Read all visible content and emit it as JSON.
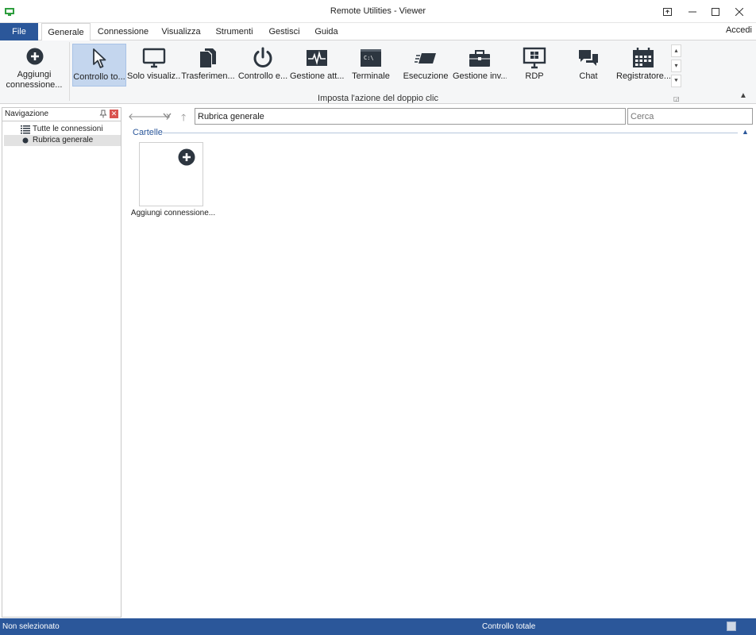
{
  "window": {
    "title": "Remote Utilities - Viewer"
  },
  "tabs": [
    {
      "label": "File"
    },
    {
      "label": "Generale"
    },
    {
      "label": "Connessione"
    },
    {
      "label": "Visualizza"
    },
    {
      "label": "Strumenti"
    },
    {
      "label": "Gestisci"
    },
    {
      "label": "Guida"
    }
  ],
  "accedi": "Accedi",
  "ribbon": {
    "add_connection_label": "Aggiungi connessione...",
    "gallery": [
      {
        "label": "Controllo to...",
        "icon": "cursor-icon"
      },
      {
        "label": "Solo visualiz...",
        "icon": "monitor-icon"
      },
      {
        "label": "Trasferimen...",
        "icon": "files-icon"
      },
      {
        "label": "Controllo e...",
        "icon": "power-icon"
      },
      {
        "label": "Gestione att...",
        "icon": "activity-monitor-icon"
      },
      {
        "label": "Terminale",
        "icon": "terminal-icon"
      },
      {
        "label": "Esecuzione",
        "icon": "execute-icon"
      },
      {
        "label": "Gestione inv...",
        "icon": "inventory-icon"
      },
      {
        "label": "RDP",
        "icon": "rdp-icon"
      },
      {
        "label": "Chat",
        "icon": "chat-icon"
      },
      {
        "label": "Registratore...",
        "icon": "calendar-icon"
      }
    ],
    "terminal_glyph": "C:\\",
    "group_label": "Imposta l'azione del doppio clic"
  },
  "navigation": {
    "title": "Navigazione",
    "items": [
      {
        "label": "Tutte le connessioni",
        "icon": "list-icon"
      },
      {
        "label": "Rubrica generale",
        "icon": "dot-icon"
      }
    ]
  },
  "address": {
    "value": "Rubrica generale"
  },
  "search": {
    "placeholder": "Cerca"
  },
  "content": {
    "section_title": "Cartelle",
    "card_label": "Aggiungi connessione..."
  },
  "status": {
    "left": "Non selezionato",
    "center": "Controllo totale"
  },
  "colors": {
    "accent": "#2b579a",
    "selected": "#c4d6ee",
    "icon_dark": "#2d3640"
  }
}
